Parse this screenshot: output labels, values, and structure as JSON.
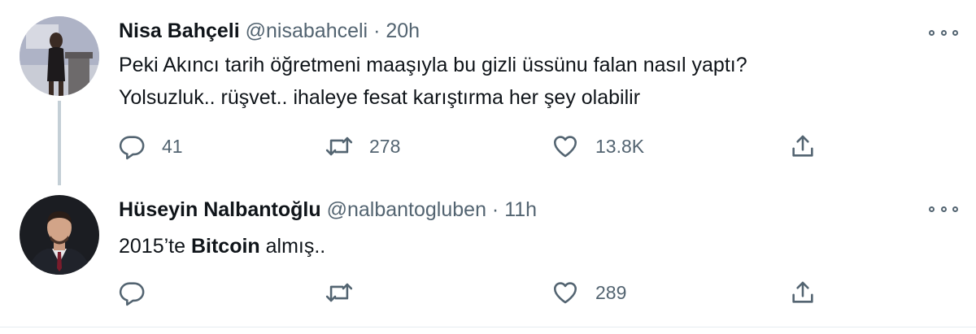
{
  "colors": {
    "text": "#0f1419",
    "secondary": "#536471",
    "thread_line": "#c4cfd6"
  },
  "tweets": [
    {
      "name": "Nisa Bahçeli",
      "handle": "@nisabahceli",
      "separator": "·",
      "time": "20h",
      "lines": [
        "Peki Akıncı tarih öğretmeni maaşıyla bu gizli üssünu falan nasıl yaptı?",
        "Yolsuzluk.. rüşvet.. ihaleye fesat karıştırma her şey olabilir"
      ],
      "replies": "41",
      "retweets": "278",
      "likes": "13.8K",
      "icons": [
        "reply-icon",
        "retweet-icon",
        "like-icon",
        "share-icon",
        "more-icon"
      ]
    },
    {
      "name": "Hüseyin Nalbantoğlu",
      "handle": "@nalbantogluben",
      "separator": "·",
      "time": "11h",
      "text_pre": "2015’te ",
      "text_bold": "Bitcoin",
      "text_post": " almış..",
      "replies": "",
      "retweets": "",
      "likes": "289",
      "icons": [
        "reply-icon",
        "retweet-icon",
        "like-icon",
        "share-icon",
        "more-icon"
      ]
    }
  ]
}
